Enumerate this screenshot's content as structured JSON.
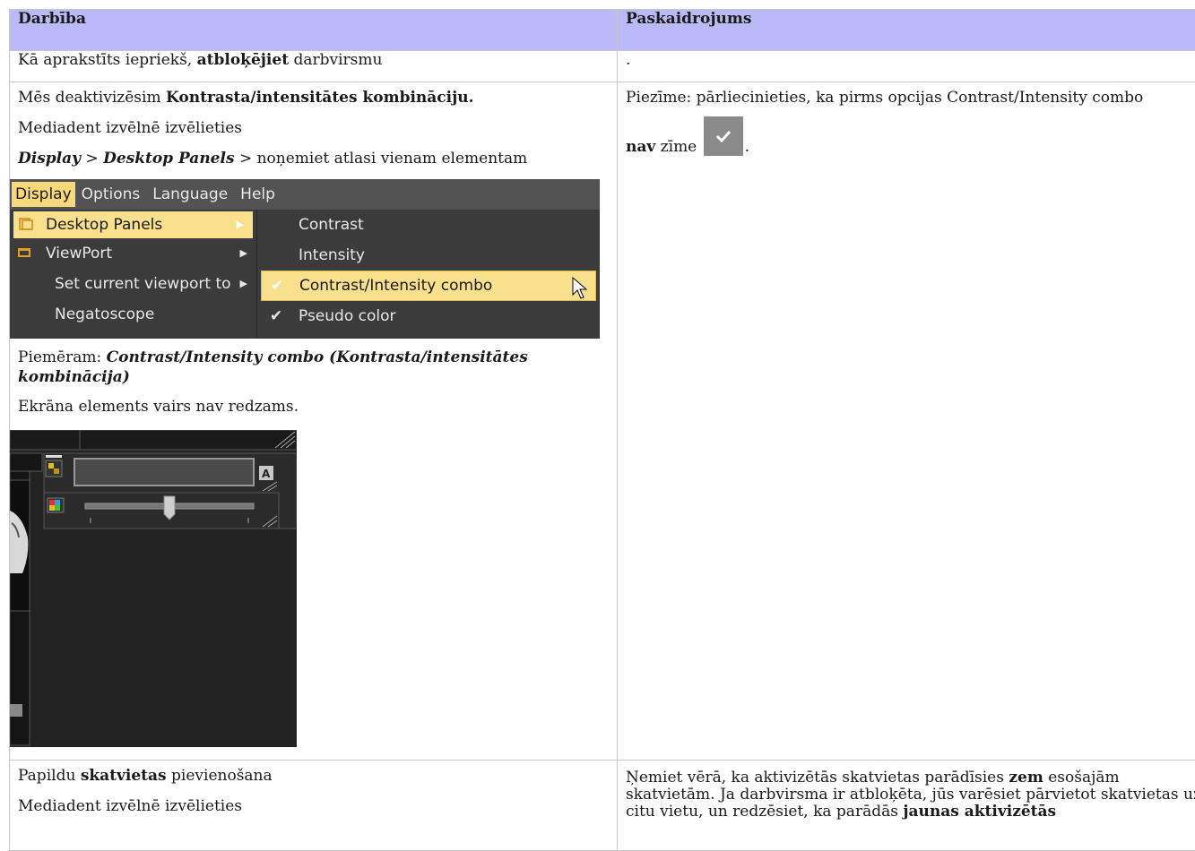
{
  "header": {
    "col1": "Darbība",
    "col2": "Paskaidrojums"
  },
  "row1": {
    "col1_before": "Kā aprakstīts iepriekš,",
    "col1_bold": "atbloķējiet",
    "col1_after": "darbvirsmu",
    "col2": "."
  },
  "row2": {
    "line1_before": "Mēs deaktivizēsim",
    "line1_bold": "Kontrasta/intensitātes kombināciju.",
    "line2": "Mediadent izvēlnē izvēlieties",
    "line3_bi1": "Display",
    "line3_sep1": ">",
    "line3_bi2": "Desktop Panels",
    "line3_sep2": ">",
    "line3_after": "noņemiet atlasi vienam elementam",
    "menu": {
      "bar": [
        "Display",
        "Options",
        "Language",
        "Help"
      ],
      "left_items": [
        "Desktop Panels",
        "ViewPort",
        "Set current viewport to",
        "Negatoscope"
      ],
      "sub_items": [
        "Contrast",
        "Intensity",
        "Contrast/Intensity combo",
        "Pseudo color"
      ]
    },
    "example_label": "Piemēram:",
    "example_bi": "Contrast/Intensity combo (Kontrasta/intensitātes kombinācija)",
    "result": "Ekrāna elements vairs nav redzams.",
    "note_line1": "Piezīme: pārliecinieties, ka pirms opcijas Contrast/Intensity combo",
    "note_bold": "nav",
    "note_after": "zīme",
    "note_end": "."
  },
  "row3": {
    "col1_before": "Papildu",
    "col1_bold": "skatvietas",
    "col1_after": "pievienošana",
    "col1_line2": "Mediadent izvēlnē izvēlieties",
    "col2_a": "Ņemiet vērā, ka aktivizētās skatvietas parādīsies",
    "col2_bold1": "zem",
    "col2_b": "esošajām skatvietām. Ja darbvirsma ir atbloķēta, jūs varēsiet pārvietot skatvietas uz citu vietu, un redzēsiet, ka parādās",
    "col2_bold2": "jaunas aktivizētās"
  }
}
